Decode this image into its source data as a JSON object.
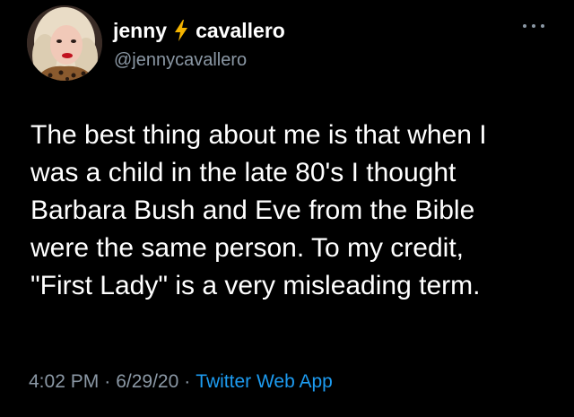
{
  "tweet": {
    "author": {
      "first_name": "jenny",
      "last_name": "cavallero",
      "handle": "@jennycavallero",
      "name_emoji": "lightning-bolt"
    },
    "text_lines": [
      "The best thing about me is that when I",
      "was a child in the late 80's I thought",
      "Barbara Bush and Eve from the Bible",
      "were the same person. To my credit,",
      "\"First Lady\" is a very misleading term."
    ],
    "time": "4:02 PM",
    "date": "6/29/20",
    "separator": "·",
    "source": "Twitter Web App",
    "more_icon": "more-horizontal-icon"
  },
  "colors": {
    "background": "#000000",
    "primary_text": "#ffffff",
    "secondary_text": "#8b98a5",
    "link": "#1d9bf0",
    "bolt": "#f4b400"
  }
}
